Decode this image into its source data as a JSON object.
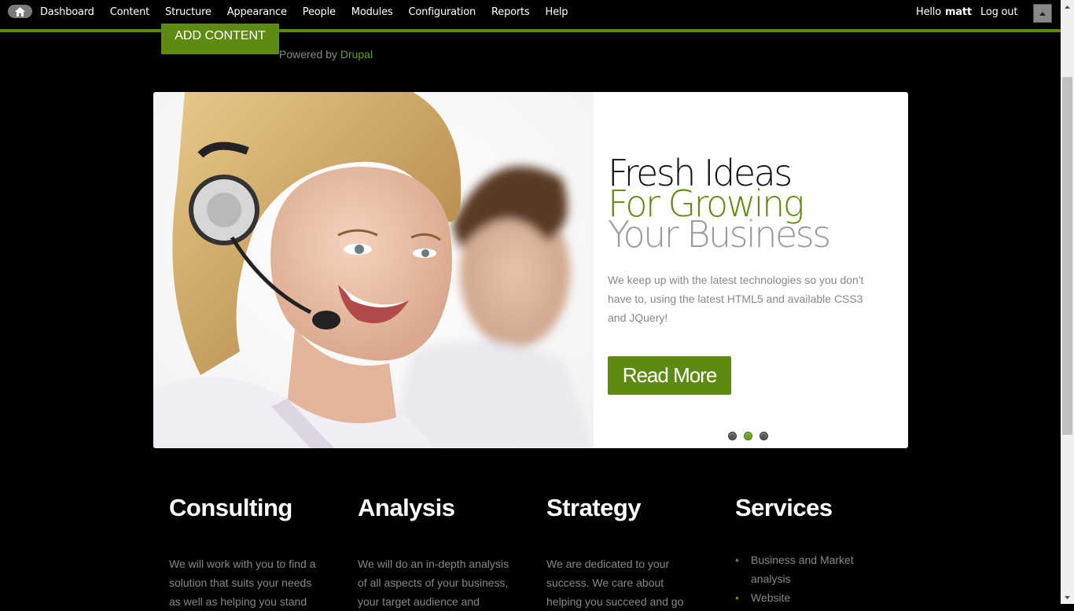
{
  "toolbar": {
    "nav": [
      "Dashboard",
      "Content",
      "Structure",
      "Appearance",
      "People",
      "Modules",
      "Configuration",
      "Reports",
      "Help"
    ],
    "hello": "Hello",
    "username": "matt",
    "logout": "Log out"
  },
  "add_content": "ADD CONTENT",
  "powered": {
    "prefix": "Powered by",
    "link": "Drupal"
  },
  "slide": {
    "line1": "Fresh Ideas",
    "line2": "For Growing",
    "line3": "Your Business",
    "text": "We keep up with the latest technologies so you don't have to, using the latest HTML5 and available CSS3 and JQuery!",
    "button": "Read More",
    "active_dot": 1
  },
  "columns": [
    {
      "title": "Consulting",
      "text": "We will work with you to find a solution that suits your needs as well as helping you stand"
    },
    {
      "title": "Analysis",
      "text": "We will do an in-depth analysis of all aspects of your business, your target audience and"
    },
    {
      "title": "Strategy",
      "text": "We are dedicated to your success. We care about helping you succeed and go"
    }
  ],
  "services": {
    "title": "Services",
    "items": [
      "Business and Market analysis",
      "Website"
    ]
  },
  "colors": {
    "accent": "#5e8a12",
    "toolbar_border": "#5a8a0e"
  }
}
